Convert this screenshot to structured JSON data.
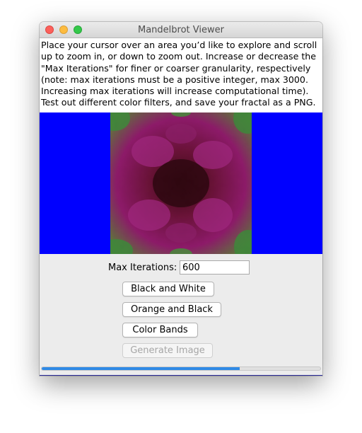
{
  "window": {
    "title": "Mandelbrot Viewer"
  },
  "instructions": {
    "text": "Place your cursor over an area you’d like to explore and scroll\nup to zoom in, or down to zoom out. Increase or decrease the\n\"Max Iterations\" for finer or coarser granularity, respectively\n(note: max iterations must be a positive integer, max 3000.\nIncreasing max iterations will increase computational time).\nTest out different color filters, and save your fractal as a PNG."
  },
  "canvas": {
    "background_color": "#0000ff",
    "fractal_colors": [
      "#2f0a12",
      "#8a1a5a",
      "#a22a8a",
      "#3a8a3a"
    ]
  },
  "controls": {
    "max_iterations_label": "Max Iterations:",
    "max_iterations_value": "600",
    "buttons": {
      "black_white": "Black and White",
      "orange_black": "Orange and Black",
      "color_bands": "Color Bands",
      "generate_image": "Generate Image"
    },
    "progress_fraction": 0.71
  }
}
